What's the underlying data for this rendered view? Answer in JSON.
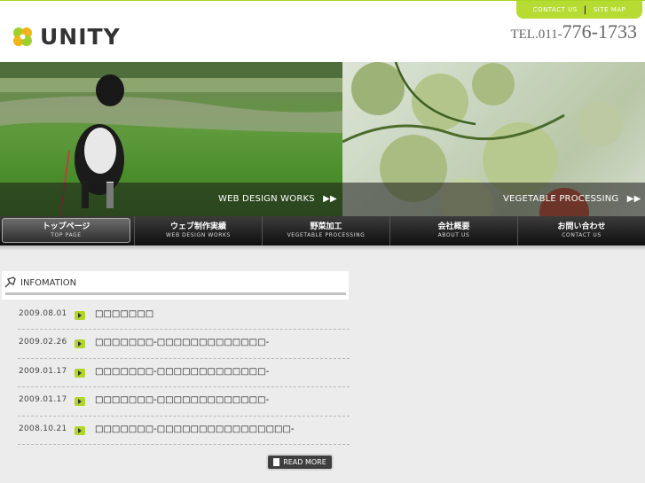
{
  "header": {
    "logo_text": "UNITY",
    "topnav": [
      "CONTACT US",
      "SITE MAP"
    ],
    "tel_prefix": "TEL.011-",
    "tel_number": "776-1733"
  },
  "hero": {
    "left_label": "WEB DESIGN WORKS",
    "right_label": "VEGETABLE PROCESSING"
  },
  "nav": [
    {
      "jp": "トップページ",
      "en": "TOP PAGE"
    },
    {
      "jp": "ウェブ制作実績",
      "en": "WEB DESIGN WORKS"
    },
    {
      "jp": "野菜加工",
      "en": "VEGETABLE PROCESSING"
    },
    {
      "jp": "会社概要",
      "en": "ABOUT US"
    },
    {
      "jp": "お問い合わせ",
      "en": "CONTACT US"
    }
  ],
  "info": {
    "title": "INFOMATION",
    "items": [
      {
        "date": "2009.08.01",
        "title": "□□□□□□□"
      },
      {
        "date": "2009.02.26",
        "title": "□□□□□□□-□□□□□□□□□□□□□-"
      },
      {
        "date": "2009.01.17",
        "title": "□□□□□□□-□□□□□□□□□□□□□-"
      },
      {
        "date": "2009.01.17",
        "title": "□□□□□□□-□□□□□□□□□□□□□-"
      },
      {
        "date": "2008.10.21",
        "title": "□□□□□□□-□□□□□□□□□□□□□□□□-"
      }
    ],
    "read_more": "READ MORE"
  },
  "colors": {
    "accent": "#b6dc34",
    "nav_bg": "#1a1a1a",
    "page_bg": "#ececec"
  }
}
